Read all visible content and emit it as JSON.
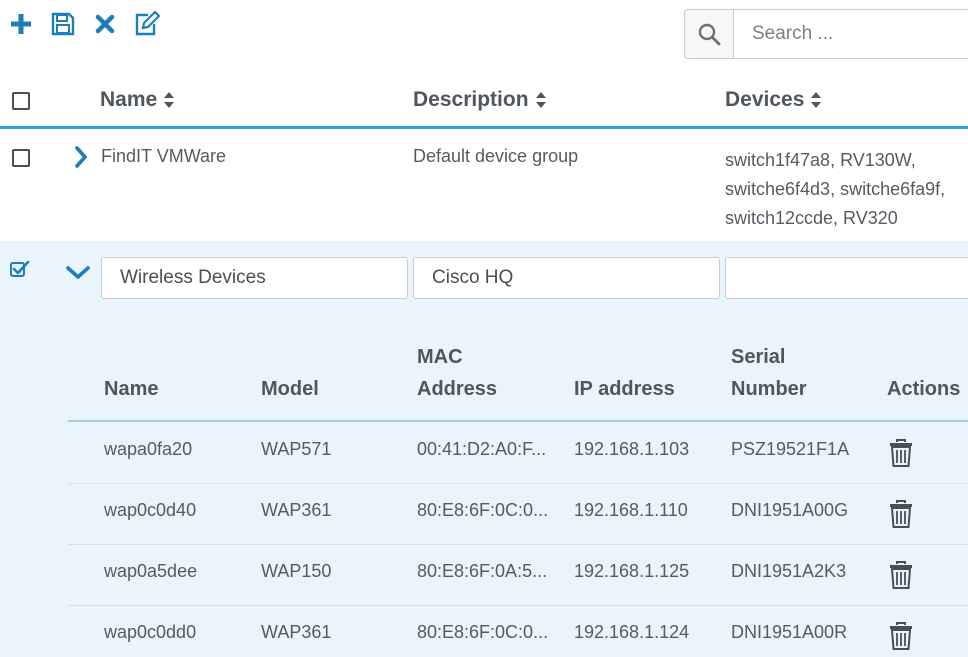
{
  "toolbar": {
    "icons": [
      "plus-icon",
      "save-icon",
      "close-icon",
      "edit-icon"
    ],
    "accent": "#1d7fb8"
  },
  "search": {
    "placeholder": "Search ..."
  },
  "table": {
    "headers": {
      "name": "Name",
      "description": "Description",
      "devices": "Devices"
    },
    "rows": [
      {
        "name": "FindIT VMWare",
        "description": "Default device group",
        "devices_lines": [
          "switch1f47a8, RV130W,",
          "switche6f4d3, switche6fa9f,",
          "switch12ccde, RV320"
        ],
        "checked": false,
        "expanded": false
      },
      {
        "name": "Wireless Devices",
        "description": "Cisco HQ",
        "devices": "",
        "checked": true,
        "expanded": true
      }
    ]
  },
  "subtable": {
    "headers": {
      "name": "Name",
      "model": "Model",
      "mac_1": "MAC",
      "mac_2": "Address",
      "ip": "IP address",
      "serial_1": "Serial",
      "serial_2": "Number",
      "actions": "Actions"
    },
    "rows": [
      {
        "name": "wapa0fa20",
        "model": "WAP571",
        "mac": "00:41:D2:A0:F...",
        "ip": "192.168.1.103",
        "serial": "PSZ19521F1A"
      },
      {
        "name": "wap0c0d40",
        "model": "WAP361",
        "mac": "80:E8:6F:0C:0...",
        "ip": "192.168.1.110",
        "serial": "DNI1951A00G"
      },
      {
        "name": "wap0a5dee",
        "model": "WAP150",
        "mac": "80:E8:6F:0A:5...",
        "ip": "192.168.1.125",
        "serial": "DNI1951A2K3"
      },
      {
        "name": "wap0c0dd0",
        "model": "WAP361",
        "mac": "80:E8:6F:0C:0...",
        "ip": "192.168.1.124",
        "serial": "DNI1951A00R"
      }
    ]
  },
  "colors": {
    "accent_blue": "#2f9fd8",
    "icon_blue": "#1d7fb8",
    "expanded_bg": "#e9f4fb"
  }
}
